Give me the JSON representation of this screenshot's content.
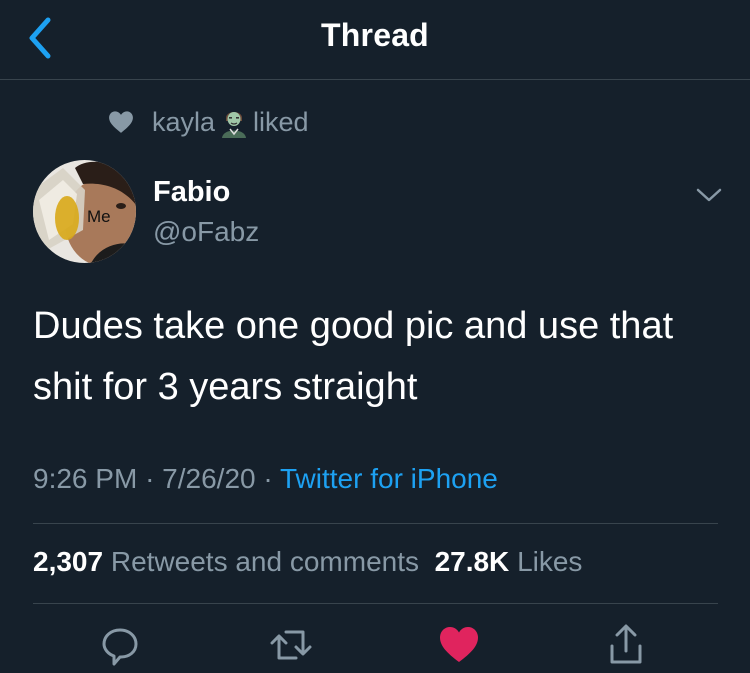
{
  "header": {
    "title": "Thread"
  },
  "social_context": {
    "liker": "kayla",
    "action": "liked",
    "heart_icon": "heart-outline-icon",
    "emoji_icon": "zombie-woman-emoji"
  },
  "tweet": {
    "avatar_text": "Me",
    "display_name": "Fabio",
    "handle": "@oFabz",
    "text": "Dudes take one good pic and use that shit for 3 years straight",
    "time": "9:26 PM",
    "date": "7/26/20",
    "separator": "·",
    "source": "Twitter for iPhone"
  },
  "stats": {
    "retweets_count": "2,307",
    "retweets_label": "Retweets and comments",
    "likes_count": "27.8K",
    "likes_label": "Likes"
  },
  "actions": [
    {
      "name": "reply",
      "icon": "speech-bubble-icon"
    },
    {
      "name": "retweet",
      "icon": "retweet-arrows-icon"
    },
    {
      "name": "like",
      "icon": "heart-filled-icon",
      "active": true
    },
    {
      "name": "share",
      "icon": "share-arrow-icon"
    }
  ],
  "colors": {
    "background": "#15202b",
    "accent": "#1da1f2",
    "like_active": "#e0245e",
    "secondary_text": "#8899a6",
    "divider": "#38444d"
  }
}
